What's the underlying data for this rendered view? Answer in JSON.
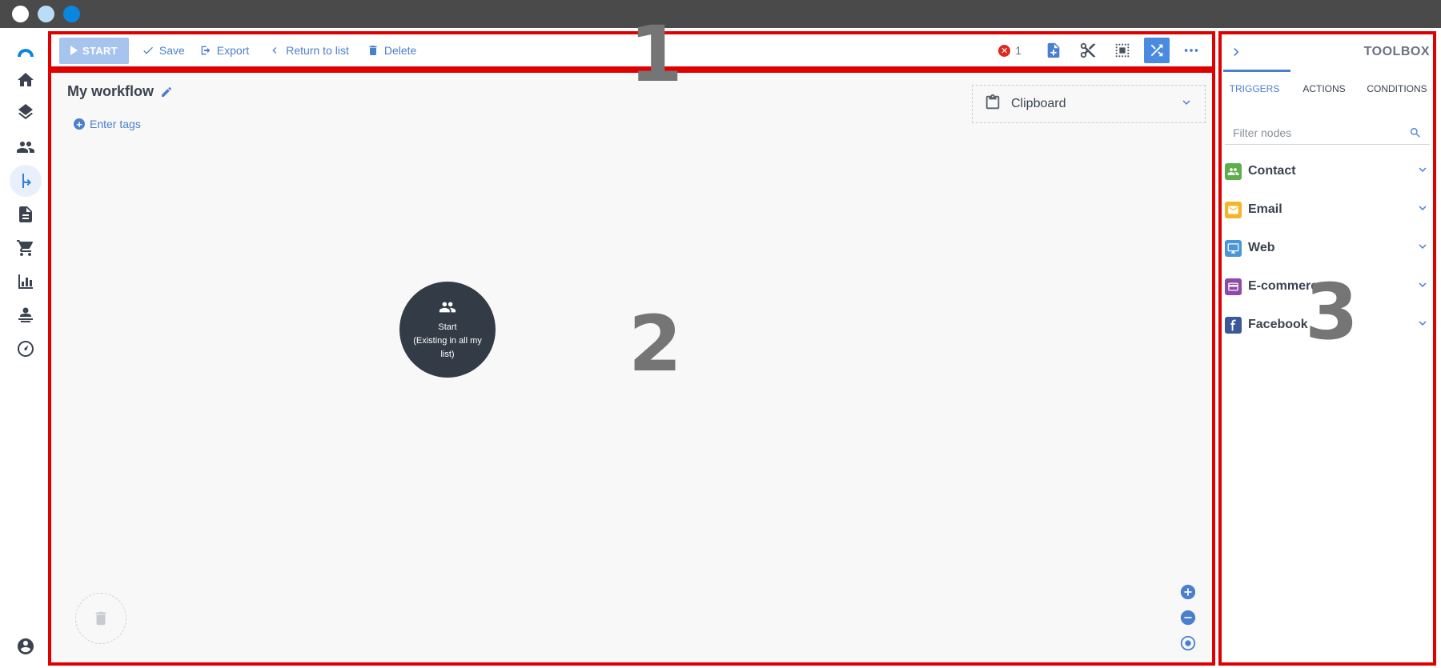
{
  "toolbar": {
    "start_label": "START",
    "save_label": "Save",
    "export_label": "Export",
    "return_label": "Return to list",
    "delete_label": "Delete",
    "error_count": "1"
  },
  "workflow": {
    "title": "My workflow",
    "tags_label": "Enter tags",
    "clipboard_label": "Clipboard",
    "start_node": {
      "title": "Start",
      "subtitle": "(Existing in all my list)"
    }
  },
  "toolbox": {
    "title": "TOOLBOX",
    "tabs": [
      {
        "label": "TRIGGERS",
        "active": true
      },
      {
        "label": "ACTIONS",
        "active": false
      },
      {
        "label": "CONDITIONS",
        "active": false
      }
    ],
    "filter_placeholder": "Filter nodes",
    "categories": [
      {
        "label": "Contact",
        "color": "#5fae4e",
        "icon": "people-icon"
      },
      {
        "label": "Email",
        "color": "#f5b52b",
        "icon": "mail-icon"
      },
      {
        "label": "Web",
        "color": "#4a97d8",
        "icon": "monitor-icon"
      },
      {
        "label": "E-commerce",
        "color": "#8e4aa6",
        "icon": "card-icon"
      },
      {
        "label": "Facebook",
        "color": "#3b5998",
        "icon": "facebook-icon"
      }
    ]
  },
  "annotations": {
    "region1": "1",
    "region2": "2",
    "region3": "3"
  },
  "colors": {
    "accent": "#4a7fd0",
    "frame": "#e00000",
    "node": "#333b46"
  }
}
